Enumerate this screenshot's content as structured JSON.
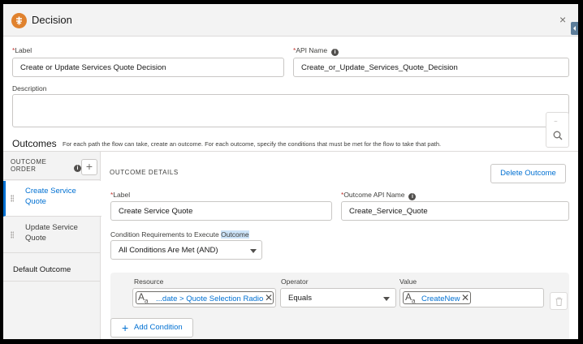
{
  "header": {
    "title": "Decision",
    "close": "×"
  },
  "label_field": {
    "label": "Label",
    "value": "Create or Update Services Quote Decision"
  },
  "api_name_field": {
    "label": "API Name",
    "value": "Create_or_Update_Services_Quote_Decision"
  },
  "description_field": {
    "label": "Description",
    "value": ""
  },
  "outcomes": {
    "title": "Outcomes",
    "description": "For each path the flow can take, create an outcome. For each outcome, specify the conditions that must be met for the flow to take that path."
  },
  "sidebar": {
    "order_label_line1": "OUTCOME",
    "order_label_line2": "ORDER",
    "add": "+",
    "items": [
      {
        "label": "Create Service Quote",
        "selected": true
      },
      {
        "label": "Update Service Quote",
        "selected": false
      }
    ],
    "default_outcome": "Default Outcome"
  },
  "details": {
    "heading": "OUTCOME DETAILS",
    "delete_button": "Delete Outcome",
    "label_label": "Label",
    "label_value": "Create Service Quote",
    "api_label": "Outcome API Name",
    "api_value": "Create_Service_Quote",
    "cond_req_label_prefix": "Condition Requirements to Execute ",
    "cond_req_label_highlight": "Outcome",
    "cond_req_value": "All Conditions Are Met (AND)"
  },
  "condition": {
    "resource_label": "Resource",
    "resource_value": "...date > Quote Selection Radio",
    "operator_label": "Operator",
    "operator_value": "Equals",
    "value_label": "Value",
    "value_value": "CreateNew",
    "add_condition": "Add Condition"
  },
  "colors": {
    "accent": "#0070d2",
    "decision_icon": "#e0822e",
    "required": "#c23934"
  },
  "icons": [
    "decision-icon",
    "close-icon",
    "info-icon",
    "search-icon",
    "drag-handle-icon",
    "chevron-down-icon",
    "text-type-icon",
    "remove-icon",
    "trash-icon",
    "add-icon"
  ]
}
